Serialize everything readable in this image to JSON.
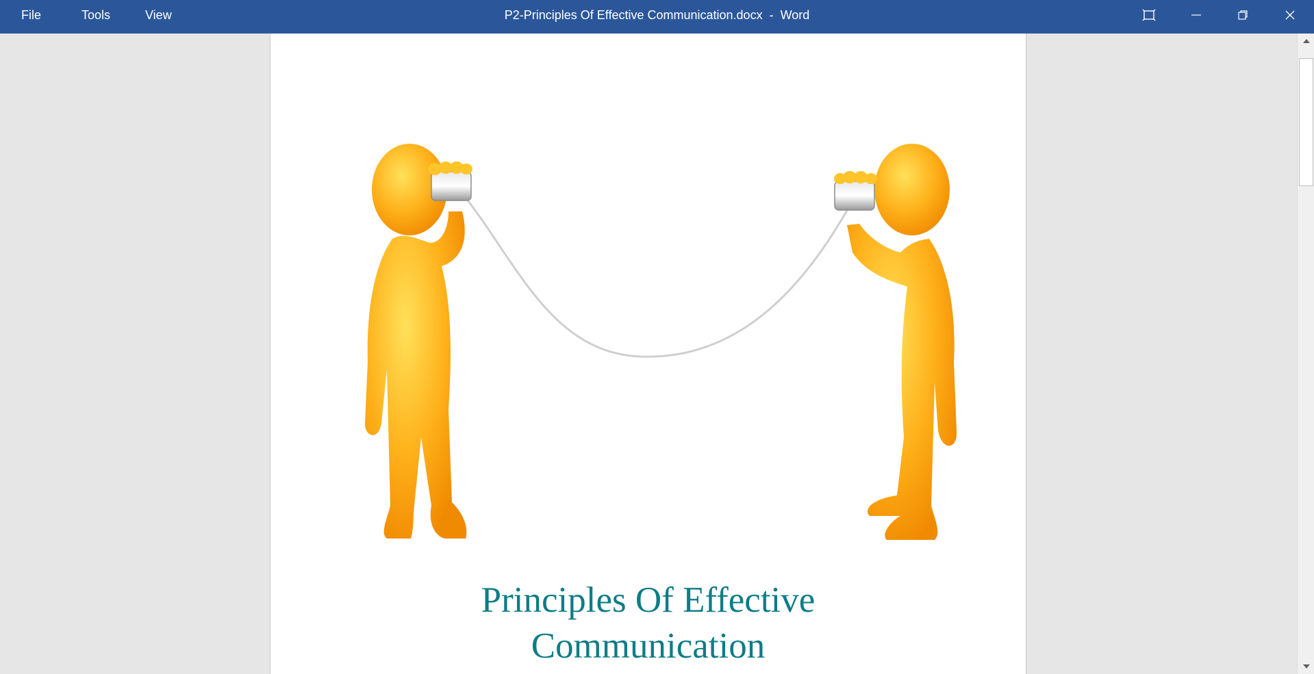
{
  "menu": {
    "items": [
      {
        "label": "File"
      },
      {
        "label": "Tools"
      },
      {
        "label": "View"
      }
    ]
  },
  "window": {
    "title": "P2-Principles Of Effective Communication.docx  -  Word",
    "icons": [
      "focus-mode-icon",
      "minimize-icon",
      "restore-icon",
      "close-icon"
    ]
  },
  "document": {
    "illustration": "two-figures-tin-can-phone",
    "title_line1": "Principles Of Effective",
    "title_line2": "Communication"
  },
  "colors": {
    "titlebar": "#2b579a",
    "title_text": "#0e7c86",
    "figure": "#ffad1f"
  }
}
